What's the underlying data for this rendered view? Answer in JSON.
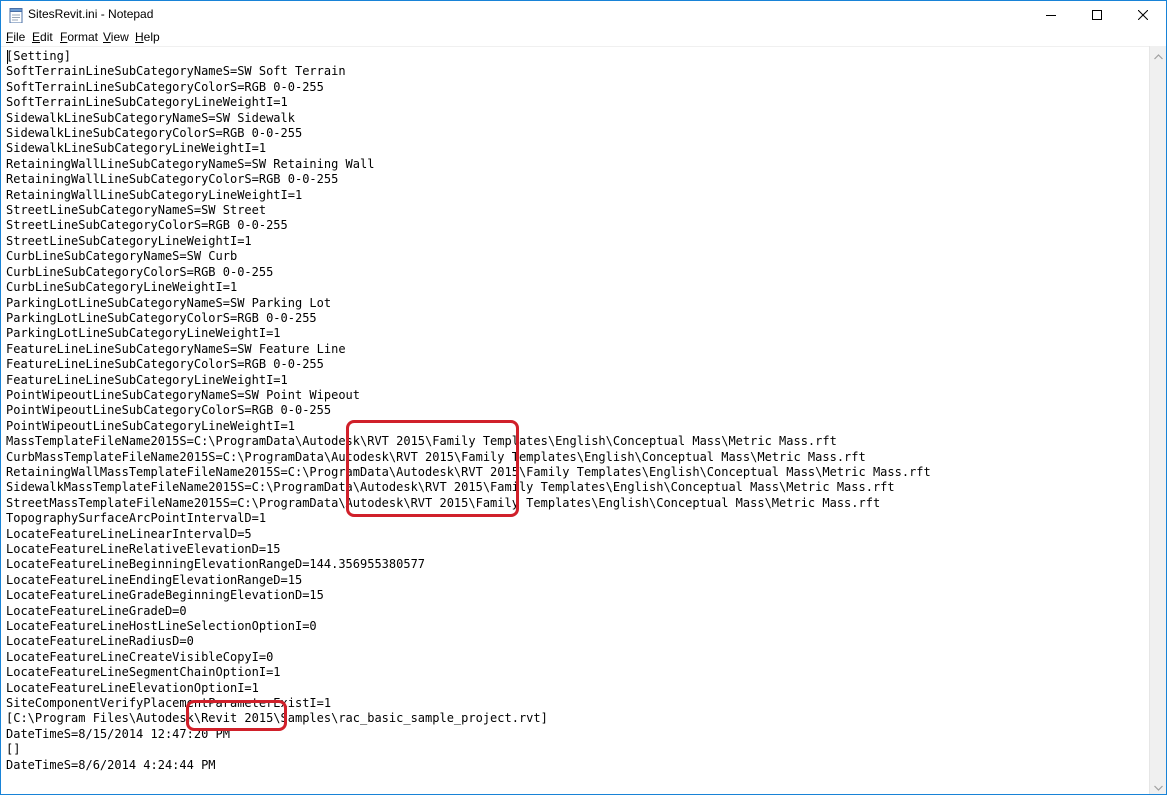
{
  "window": {
    "title": "SitesRevit.ini - Notepad"
  },
  "menu": {
    "file": "File",
    "edit": "Edit",
    "format": "Format",
    "view": "View",
    "help": "Help"
  },
  "icons": {
    "app": "notepad-icon",
    "minimize": "minimize-icon",
    "maximize": "maximize-icon",
    "close": "close-icon",
    "scroll_up": "chevron-up-icon",
    "scroll_down": "chevron-down-icon"
  },
  "colors": {
    "annotation": "#d0202a",
    "window_border": "#1883d7"
  },
  "editor": {
    "lines": [
      "[Setting]",
      "SoftTerrainLineSubCategoryNameS=SW Soft Terrain",
      "SoftTerrainLineSubCategoryColorS=RGB 0-0-255",
      "SoftTerrainLineSubCategoryLineWeightI=1",
      "SidewalkLineSubCategoryNameS=SW Sidewalk",
      "SidewalkLineSubCategoryColorS=RGB 0-0-255",
      "SidewalkLineSubCategoryLineWeightI=1",
      "RetainingWallLineSubCategoryNameS=SW Retaining Wall",
      "RetainingWallLineSubCategoryColorS=RGB 0-0-255",
      "RetainingWallLineSubCategoryLineWeightI=1",
      "StreetLineSubCategoryNameS=SW Street",
      "StreetLineSubCategoryColorS=RGB 0-0-255",
      "StreetLineSubCategoryLineWeightI=1",
      "CurbLineSubCategoryNameS=SW Curb",
      "CurbLineSubCategoryColorS=RGB 0-0-255",
      "CurbLineSubCategoryLineWeightI=1",
      "ParkingLotLineSubCategoryNameS=SW Parking Lot",
      "ParkingLotLineSubCategoryColorS=RGB 0-0-255",
      "ParkingLotLineSubCategoryLineWeightI=1",
      "FeatureLineLineSubCategoryNameS=SW Feature Line",
      "FeatureLineLineSubCategoryColorS=RGB 0-0-255",
      "FeatureLineLineSubCategoryLineWeightI=1",
      "PointWipeoutLineSubCategoryNameS=SW Point Wipeout",
      "PointWipeoutLineSubCategoryColorS=RGB 0-0-255",
      "PointWipeoutLineSubCategoryLineWeightI=1",
      "MassTemplateFileName2015S=C:\\ProgramData\\Autodesk\\RVT 2015\\Family Templates\\English\\Conceptual Mass\\Metric Mass.rft",
      "CurbMassTemplateFileName2015S=C:\\ProgramData\\Autodesk\\RVT 2015\\Family Templates\\English\\Conceptual Mass\\Metric Mass.rft",
      "RetainingWallMassTemplateFileName2015S=C:\\ProgramData\\Autodesk\\RVT 2015\\Family Templates\\English\\Conceptual Mass\\Metric Mass.rft",
      "SidewalkMassTemplateFileName2015S=C:\\ProgramData\\Autodesk\\RVT 2015\\Family Templates\\English\\Conceptual Mass\\Metric Mass.rft",
      "StreetMassTemplateFileName2015S=C:\\ProgramData\\Autodesk\\RVT 2015\\Family Templates\\English\\Conceptual Mass\\Metric Mass.rft",
      "TopographySurfaceArcPointIntervalD=1",
      "LocateFeatureLineLinearIntervalD=5",
      "LocateFeatureLineRelativeElevationD=15",
      "LocateFeatureLineBeginningElevationRangeD=144.356955380577",
      "LocateFeatureLineEndingElevationRangeD=15",
      "LocateFeatureLineGradeBeginningElevationD=15",
      "LocateFeatureLineGradeD=0",
      "LocateFeatureLineHostLineSelectionOptionI=0",
      "LocateFeatureLineRadiusD=0",
      "LocateFeatureLineCreateVisibleCopyI=0",
      "LocateFeatureLineSegmentChainOptionI=1",
      "LocateFeatureLineElevationOptionI=1",
      "SiteComponentVerifyPlacementParameterExistI=1",
      "[C:\\Program Files\\Autodesk\\Revit 2015\\Samples\\rac_basic_sample_project.rvt]",
      "DateTimeS=8/15/2014 12:47:20 PM",
      "[]",
      "DateTimeS=8/6/2014 4:24:44 PM"
    ]
  }
}
